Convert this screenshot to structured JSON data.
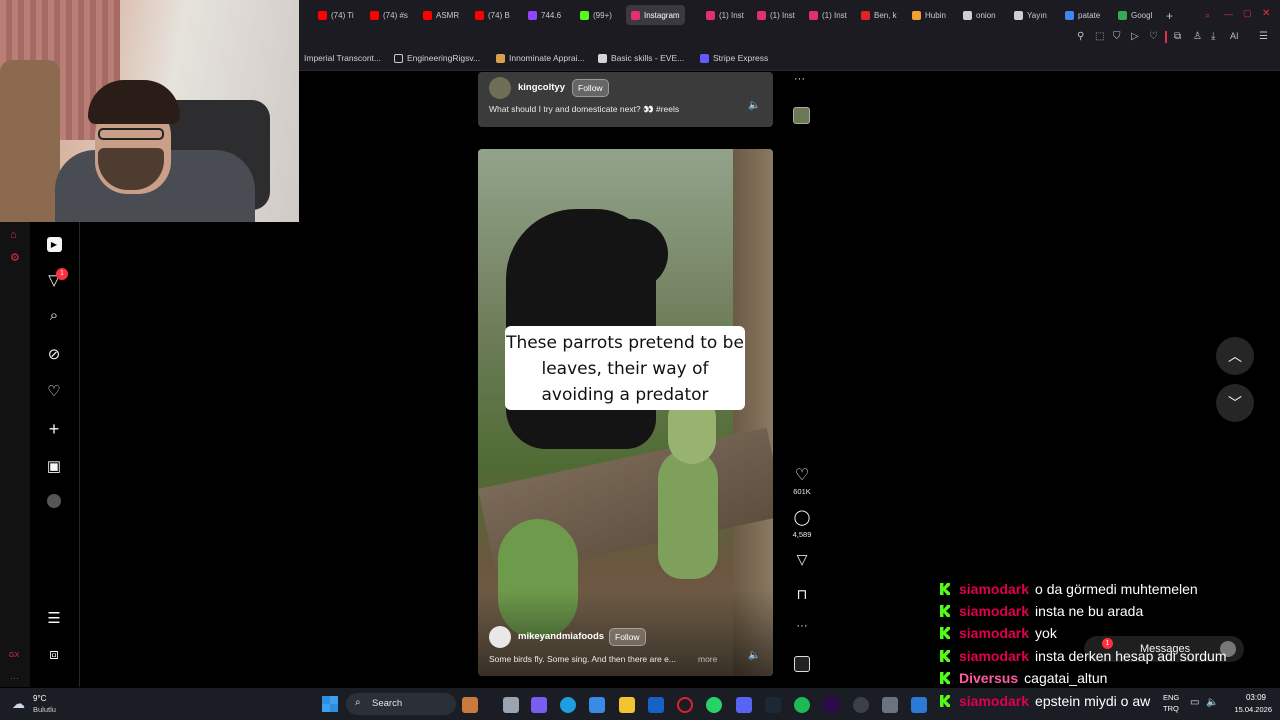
{
  "browser": {
    "tabs": [
      {
        "label": "(74) Ti",
        "color": "#ff0000"
      },
      {
        "label": "(74) #s",
        "color": "#ff0000"
      },
      {
        "label": "ASMR",
        "color": "#ff0000"
      },
      {
        "label": "(74) B",
        "color": "#ff0000"
      },
      {
        "label": "744.6",
        "color": "#9146ff"
      },
      {
        "label": "(99+)",
        "color": "#53fc18"
      },
      {
        "label": "Instagram",
        "color": "#e1306c",
        "active": true
      },
      {
        "label": "(1) Inst",
        "color": "#e1306c"
      },
      {
        "label": "(1) Inst",
        "color": "#e1306c"
      },
      {
        "label": "(1) Inst",
        "color": "#e1306c"
      },
      {
        "label": "Ben, k",
        "color": "#e02424"
      },
      {
        "label": "Hubin",
        "color": "#f0a030"
      },
      {
        "label": "onion",
        "color": "#cfcfcf"
      },
      {
        "label": "Yayın",
        "color": "#cfcfcf"
      },
      {
        "label": "patate",
        "color": "#4285f4"
      },
      {
        "label": "Googl",
        "color": "#34a853"
      }
    ],
    "new_tab": "+",
    "toolbar_ai_label": "AI",
    "bookmarks": [
      {
        "label": "Imperial Transcont...",
        "color": "#888888"
      },
      {
        "label": "EngineeringRigsv...",
        "color": "#cccccc"
      },
      {
        "label": "Innominate Apprai...",
        "color": "#d6a050"
      },
      {
        "label": "Basic skills - EVE...",
        "color": "#d4d4d4"
      },
      {
        "label": "Stripe Express",
        "color": "#635bff"
      }
    ]
  },
  "sidebar": {
    "notification_badge": "1",
    "side_strip_text": "GX"
  },
  "feed": {
    "post_top": {
      "username": "kingcoltyy",
      "follow_label": "Follow",
      "caption": "What should I try and domesticate next? 👀 #reels"
    },
    "post_main": {
      "overlay_text": "These parrots pretend to be leaves, their way of avoiding a predator",
      "username": "mikeyandmiafoods",
      "follow_label": "Follow",
      "caption": "Some birds fly. Some sing. And then there are e...",
      "more_label": "more",
      "likes": "601K",
      "comments": "4,589"
    },
    "more_dots": "···"
  },
  "chat": [
    {
      "user": "siamodark",
      "message": "o da görmedi muhtemelen"
    },
    {
      "user": "siamodark",
      "message": "insta ne bu arada"
    },
    {
      "user": "siamodark",
      "message": "yok"
    },
    {
      "user": "siamodark",
      "message": "insta derken hesap adi sordum"
    },
    {
      "user": "Diversus",
      "message": "cagatai_altun"
    },
    {
      "user": "siamodark",
      "message": "epstein miydi o aw"
    }
  ],
  "messages_widget": {
    "label": "Messages",
    "badge": "1"
  },
  "taskbar": {
    "weather_temp": "9°C",
    "weather_desc": "Bulutlu",
    "search_label": "Search",
    "lang_top": "ENG",
    "lang_bottom": "TRQ",
    "time": "03:09",
    "date": "15.04.2026"
  }
}
